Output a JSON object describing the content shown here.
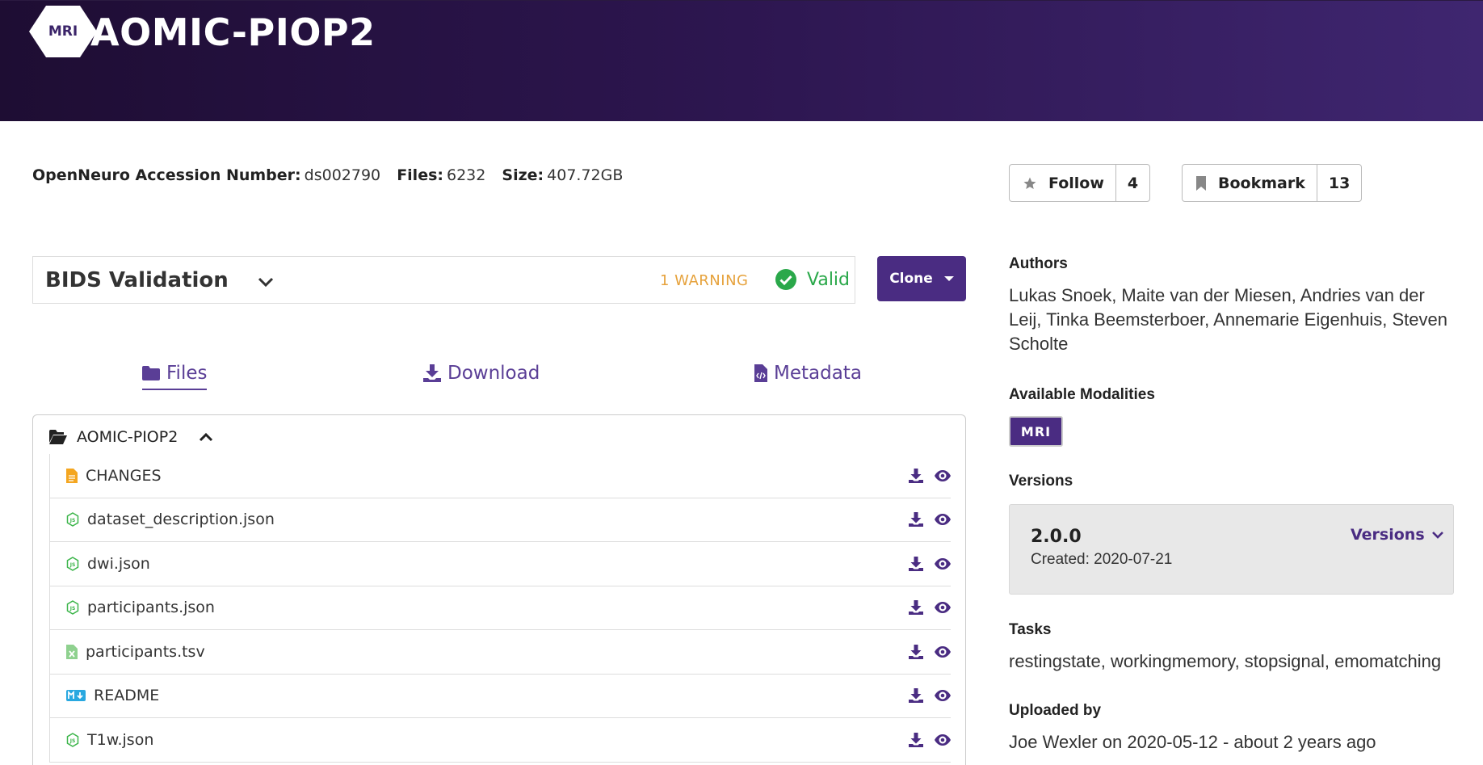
{
  "header": {
    "logo_text": "MRI",
    "title": "AOMIC-PIOP2"
  },
  "meta": {
    "accession_label": "OpenNeuro Accession Number:",
    "accession_value": "ds002790",
    "files_label": "Files:",
    "files_value": "6232",
    "size_label": "Size:",
    "size_value": "407.72GB"
  },
  "social": {
    "follow_label": "Follow",
    "follow_count": "4",
    "bookmark_label": "Bookmark",
    "bookmark_count": "13"
  },
  "validation": {
    "title": "BIDS Validation",
    "warning_text": "1 WARNING",
    "status_text": "Valid",
    "status_color": "#2aa84a",
    "warning_color": "#e6a23c"
  },
  "clone": {
    "label": "Clone"
  },
  "tabs": {
    "files": "Files",
    "download": "Download",
    "metadata": "Metadata"
  },
  "filetree": {
    "root_name": "AOMIC-PIOP2",
    "files": [
      {
        "name": "CHANGES",
        "icon": "text-file-icon"
      },
      {
        "name": "dataset_description.json",
        "icon": "json-file-icon"
      },
      {
        "name": "dwi.json",
        "icon": "json-file-icon"
      },
      {
        "name": "participants.json",
        "icon": "json-file-icon"
      },
      {
        "name": "participants.tsv",
        "icon": "spreadsheet-file-icon"
      },
      {
        "name": "README",
        "icon": "markdown-file-icon"
      },
      {
        "name": "T1w.json",
        "icon": "json-file-icon"
      }
    ]
  },
  "sidebar": {
    "authors_heading": "Authors",
    "authors_text": "Lukas Snoek, Maite van der Miesen, Andries van der Leij, Tinka Beemsterboer, Annemarie Eigenhuis, Steven Scholte",
    "modalities_heading": "Available Modalities",
    "modality_badge": "MRI",
    "versions_heading": "Versions",
    "version_number": "2.0.0",
    "version_created": "Created: 2020-07-21",
    "versions_dropdown": "Versions",
    "tasks_heading": "Tasks",
    "tasks_text": "restingstate, workingmemory, stopsignal, emomatching",
    "uploaded_heading": "Uploaded by",
    "uploaded_text": "Joe Wexler on 2020-05-12 - about 2 years ago"
  },
  "colors": {
    "accent": "#4a2c82",
    "header_gradient_start": "#1e0d33",
    "header_gradient_end": "#3f2670"
  }
}
